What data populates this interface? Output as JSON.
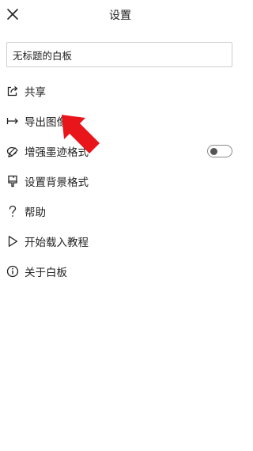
{
  "header": {
    "title": "设置",
    "close_icon": "close-icon"
  },
  "board_title": {
    "value": "无标题的白板",
    "placeholder": ""
  },
  "menu": {
    "items": [
      {
        "label": "共享",
        "icon": "share-icon"
      },
      {
        "label": "导出图像",
        "icon": "export-icon"
      },
      {
        "label": "增强墨迹格式",
        "icon": "ink-enhance-icon",
        "toggle": false
      },
      {
        "label": "设置背景格式",
        "icon": "brush-icon"
      },
      {
        "label": "帮助",
        "icon": "question-icon"
      },
      {
        "label": "开始载入教程",
        "icon": "play-icon"
      },
      {
        "label": "关于白板",
        "icon": "info-icon"
      }
    ]
  },
  "annotation": {
    "arrow_color": "#e8151b"
  }
}
